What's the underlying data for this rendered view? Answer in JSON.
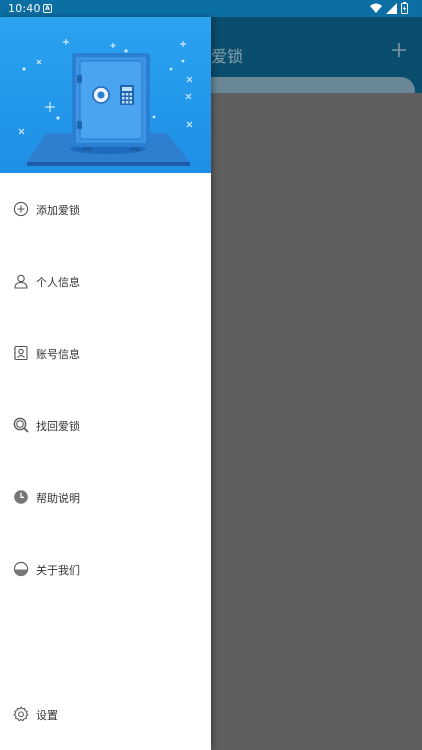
{
  "status_bar": {
    "time": "10:40",
    "notification_glyph": "A",
    "icons": [
      "wifi-icon",
      "signal-icon",
      "battery-icon"
    ]
  },
  "app": {
    "title": "爱锁",
    "add_icon": "plus-icon"
  },
  "drawer": {
    "header_art": "safe-illustration",
    "items": [
      {
        "label": "添加爱锁",
        "icon": "add-circle-icon"
      },
      {
        "label": "个人信息",
        "icon": "person-icon"
      },
      {
        "label": "账号信息",
        "icon": "contact-card-icon"
      },
      {
        "label": "找回爱锁",
        "icon": "search-icon"
      },
      {
        "label": "帮助说明",
        "icon": "clock-icon"
      },
      {
        "label": "关于我们",
        "icon": "half-circle-icon"
      }
    ],
    "settings": {
      "label": "设置",
      "icon": "gear-icon"
    }
  },
  "colors": {
    "header_blue": "#1e8fe6",
    "status_bar": "#0b6fa4",
    "scrim": "#5f5f5f",
    "text": "#333333"
  }
}
